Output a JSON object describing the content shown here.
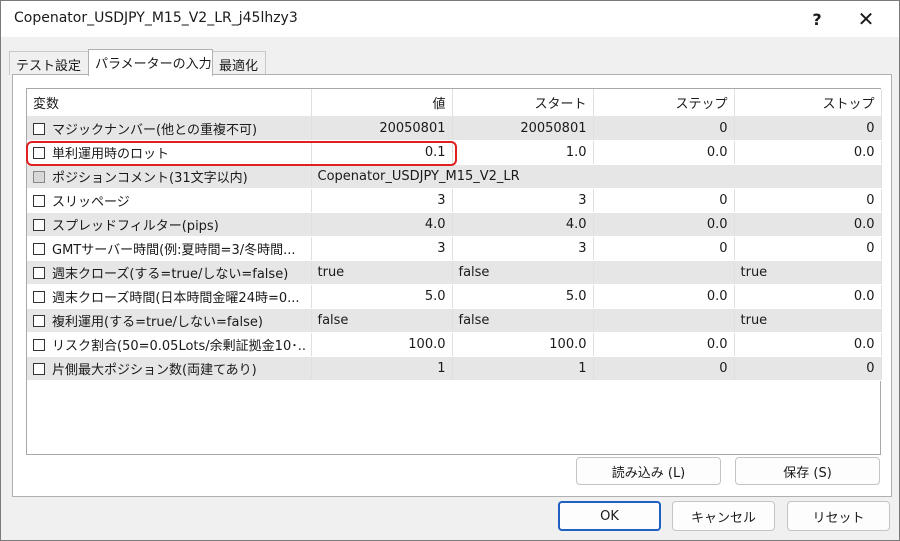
{
  "window": {
    "title": "Copenator_USDJPY_M15_V2_LR_j45lhzy3",
    "help_label": "?",
    "close_label": "✕"
  },
  "tabs": [
    {
      "label": "テスト設定"
    },
    {
      "label": "パラメーターの入力"
    },
    {
      "label": "最適化"
    }
  ],
  "grid": {
    "headers": {
      "variable": "変数",
      "value": "値",
      "start": "スタート",
      "step": "ステップ",
      "stop": "ストップ"
    },
    "rows": [
      {
        "name": "マジックナンバー(他との重複不可)",
        "value": "20050801",
        "start": "20050801",
        "step": "0",
        "stop": "0"
      },
      {
        "name": "単利運用時のロット",
        "value": "0.1",
        "start": "1.0",
        "step": "0.0",
        "stop": "0.0"
      },
      {
        "name": "ポジションコメント(31文字以内)",
        "value": "Copenator_USDJPY_M15_V2_LR",
        "start": "",
        "step": "",
        "stop": ""
      },
      {
        "name": "スリッページ",
        "value": "3",
        "start": "3",
        "step": "0",
        "stop": "0"
      },
      {
        "name": "スプレッドフィルター(pips)",
        "value": "4.0",
        "start": "4.0",
        "step": "0.0",
        "stop": "0.0"
      },
      {
        "name": "GMTサーバー時間(例:夏時間=3/冬時間...",
        "value": "3",
        "start": "3",
        "step": "0",
        "stop": "0"
      },
      {
        "name": "週末クローズ(する=true/しない=false)",
        "value": "true",
        "start": "false",
        "step": "",
        "stop": "true"
      },
      {
        "name": "週末クローズ時間(日本時間金曜24時=0...",
        "value": "5.0",
        "start": "5.0",
        "step": "0.0",
        "stop": "0.0"
      },
      {
        "name": "複利運用(する=true/しない=false)",
        "value": "false",
        "start": "false",
        "step": "",
        "stop": "true"
      },
      {
        "name": "リスク割合(50=0.05Lots/余剰証拠金10･..",
        "value": "100.0",
        "start": "100.0",
        "step": "0.0",
        "stop": "0.0"
      },
      {
        "name": "片側最大ポジション数(両建てあり)",
        "value": "1",
        "start": "1",
        "step": "0",
        "stop": "0"
      }
    ]
  },
  "buttons": {
    "load": "読み込み (L)",
    "save": "保存 (S)",
    "ok": "OK",
    "cancel": "キャンセル",
    "reset": "リセット"
  },
  "colors": {
    "highlight": "#e02020",
    "primary_border": "#2060c0",
    "alt_row": "#e6e6e6"
  }
}
